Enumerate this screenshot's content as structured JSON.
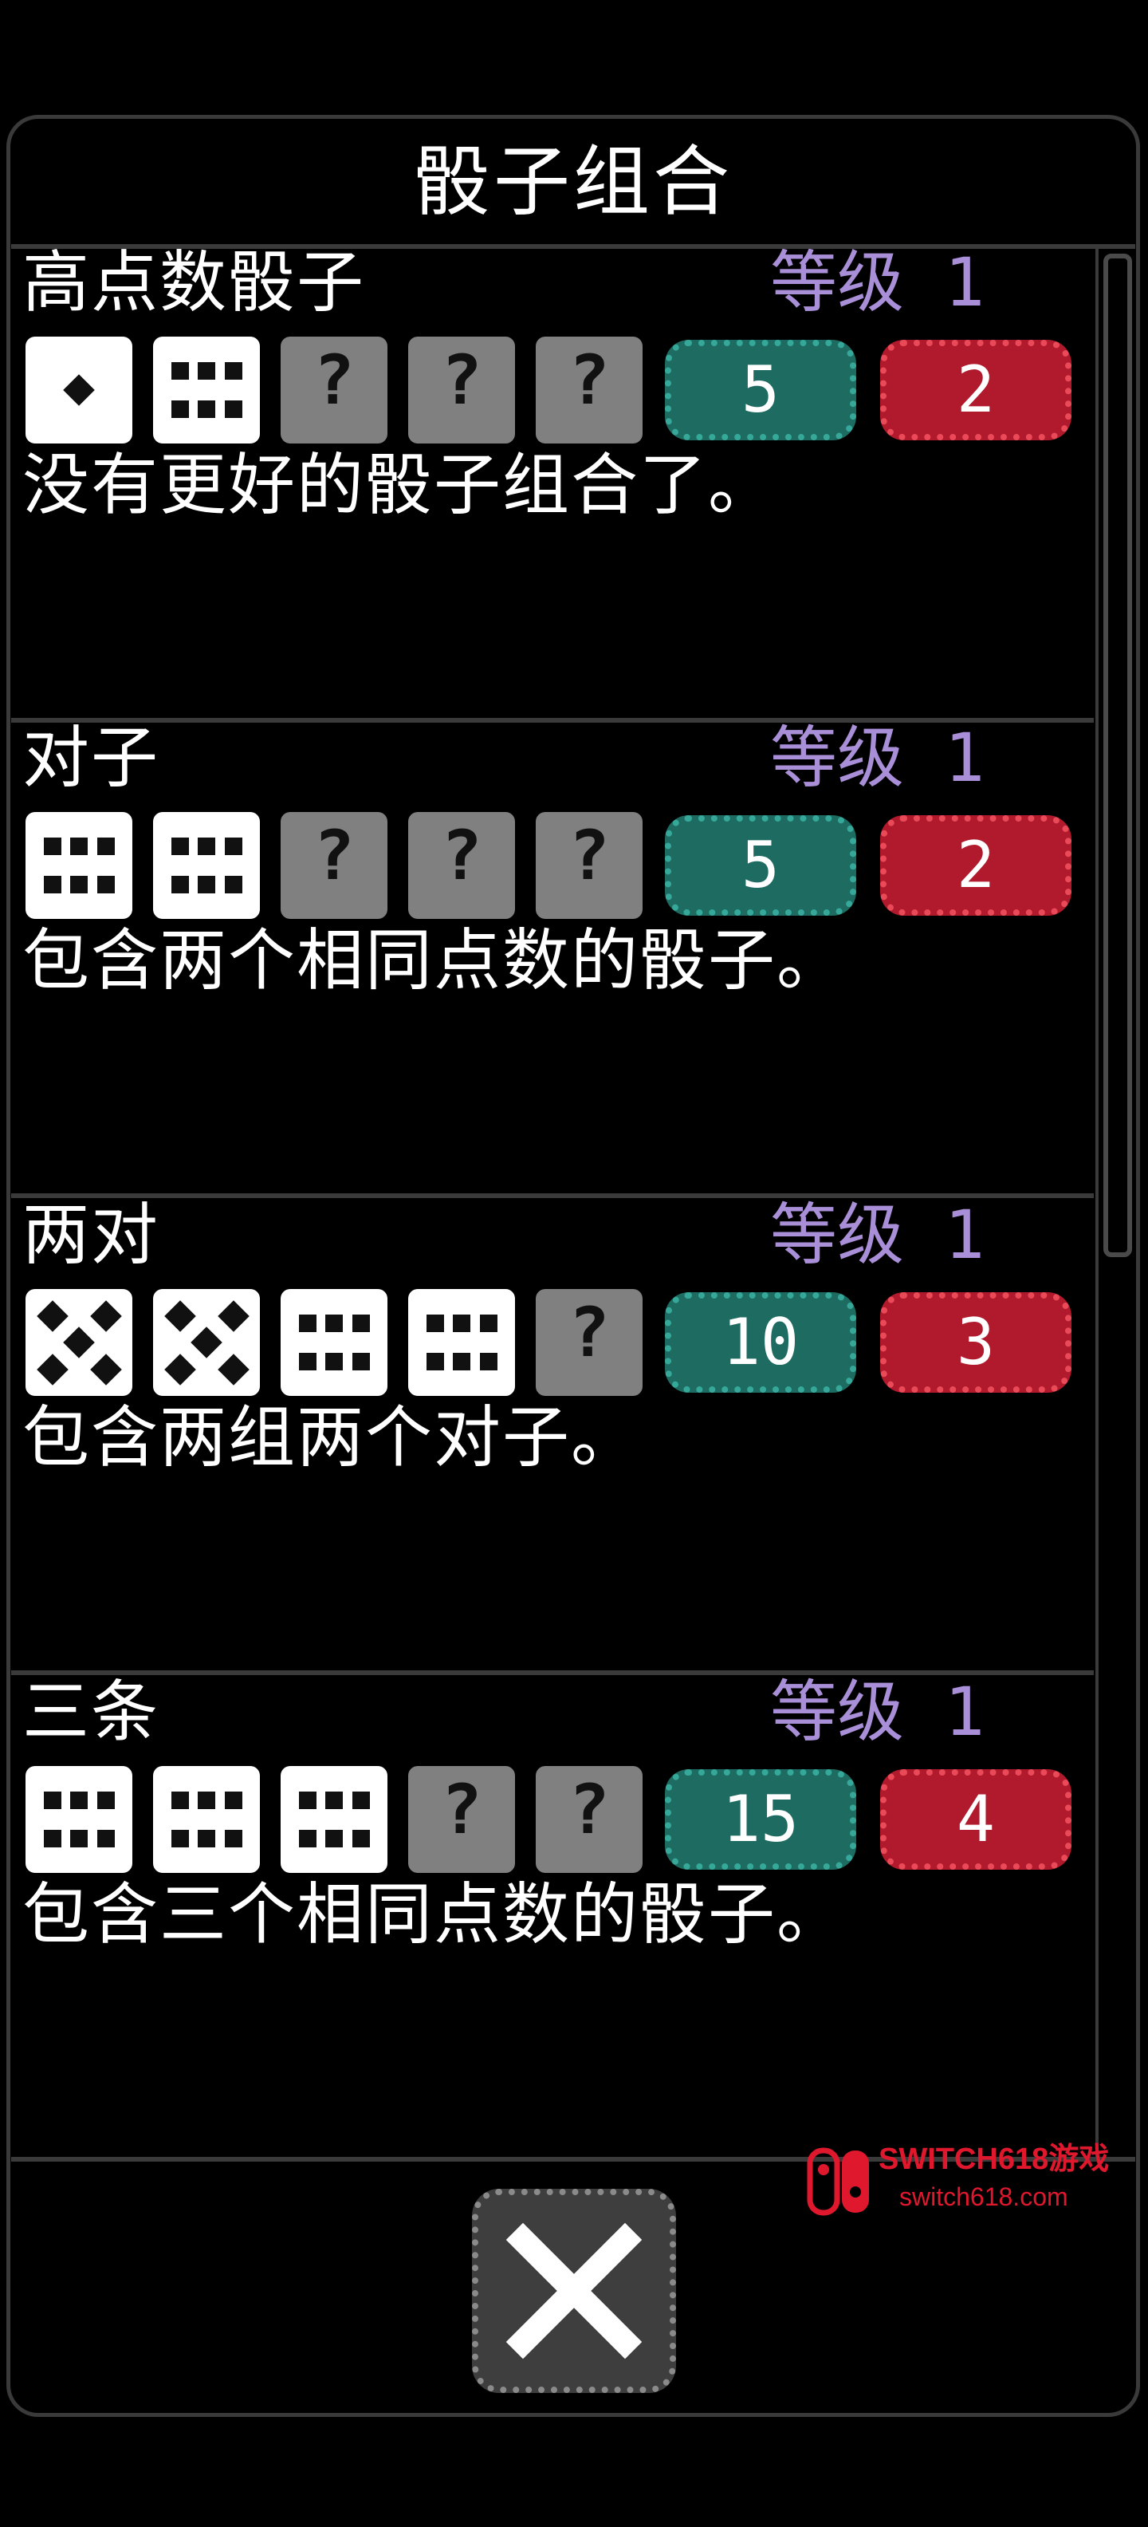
{
  "title": "骰子组合",
  "combos": [
    {
      "name": "高点数骰子",
      "level": "等级 1",
      "dice": [
        1,
        6,
        "?",
        "?",
        "?"
      ],
      "chips": "5",
      "mult": "2",
      "description": "没有更好的骰子组合了。"
    },
    {
      "name": "对子",
      "level": "等级 1",
      "dice": [
        6,
        6,
        "?",
        "?",
        "?"
      ],
      "chips": "5",
      "mult": "2",
      "description": "包含两个相同点数的骰子。"
    },
    {
      "name": "两对",
      "level": "等级 1",
      "dice": [
        5,
        5,
        6,
        6,
        "?"
      ],
      "chips": "10",
      "mult": "3",
      "description": "包含两组两个对子。"
    },
    {
      "name": "三条",
      "level": "等级 1",
      "dice": [
        6,
        6,
        6,
        "?",
        "?"
      ],
      "chips": "15",
      "mult": "4",
      "description": "包含三个相同点数的骰子。"
    }
  ],
  "scroll_position": 0.0,
  "watermark": {
    "title": "SWITCH618游戏",
    "subtitle": "switch618.com"
  },
  "colors": {
    "chips": "#1e6b61",
    "mult": "#b01a2c",
    "level": "#a98fd8",
    "unknown_die": "#808080"
  }
}
